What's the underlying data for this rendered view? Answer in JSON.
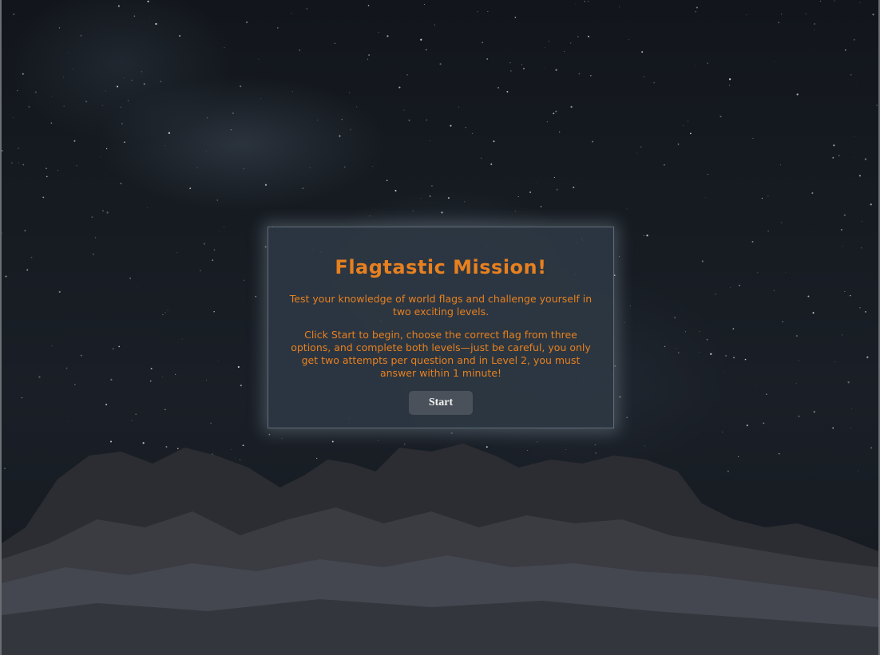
{
  "game": {
    "title": "Flagtastic Mission!",
    "intro": "Test your knowledge of world flags and challenge yourself in two exciting levels.",
    "rules": "Click Start to begin, choose the correct flag from three options, and complete both levels—just be careful, you only get two attempts per question and in Level 2, you must answer within 1 minute!",
    "start_label": "Start"
  },
  "colors": {
    "accent": "#e7801f",
    "panel": "#2d3743",
    "button": "#4a515a",
    "background": "#12161c"
  }
}
